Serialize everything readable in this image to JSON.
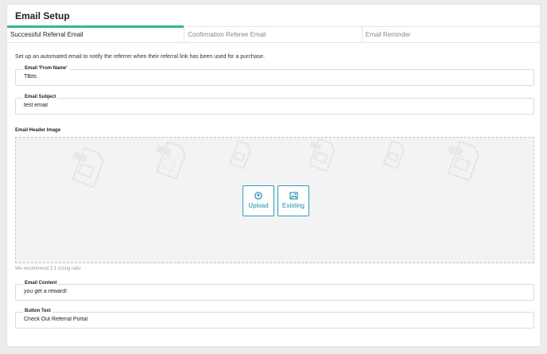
{
  "header": {
    "title": "Email Setup"
  },
  "tabs": [
    {
      "label": "Successful Referral Email",
      "active": true
    },
    {
      "label": "Confirmation Referee Email",
      "active": false
    },
    {
      "label": "Email Reminder",
      "active": false
    }
  ],
  "description": "Set up an automated email to notify the referrer when their referral link has been used for a purchase.",
  "fields": {
    "from_name": {
      "label": "Email 'From Name'",
      "value": "TBits"
    },
    "subject": {
      "label": "Email Subject",
      "value": "test email"
    },
    "content": {
      "label": "Email Content",
      "value": "you get a reward!"
    },
    "button_text": {
      "label": "Button Text",
      "value": "Check Out Referral Portal"
    }
  },
  "header_image": {
    "label": "Email Header Image",
    "upload_label": "Upload",
    "existing_label": "Existing",
    "hint": "We recommend 2:1 sizing ratio"
  },
  "colors": {
    "accent_tab": "#3bb58e",
    "button": "#1a8fab"
  }
}
